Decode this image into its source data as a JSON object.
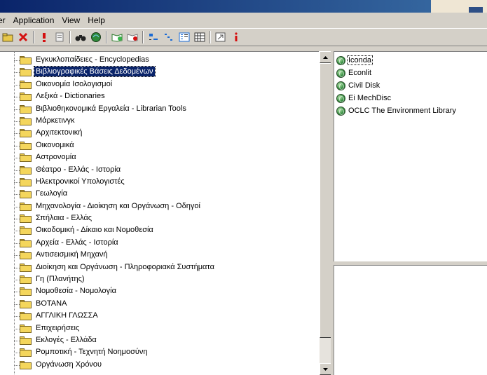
{
  "menu": {
    "items": [
      "er",
      "Application",
      "View",
      "Help"
    ]
  },
  "toolbar": {
    "icons": [
      "open-folder-icon",
      "delete-x-icon",
      "exclamation-icon",
      "document-icon",
      "binoculars-icon",
      "globe-refresh-icon",
      "open-book-icon",
      "close-book-icon",
      "sort-icon",
      "tree-view-icon",
      "details-view-icon",
      "grid-view-icon",
      "export-icon",
      "info-icon"
    ]
  },
  "tree": {
    "items": [
      {
        "label": "Εγκυκλοπαίδειες - Encyclopedias",
        "selected": false
      },
      {
        "label": "Βιβλιογραφικές Βάσεις Δεδομένων",
        "selected": true
      },
      {
        "label": "Οικονομία Ισολογισμοί",
        "selected": false
      },
      {
        "label": "Λεξικά - Dictionaries",
        "selected": false
      },
      {
        "label": "Βιβλιοθηκονομικά Εργαλεία - Librarian Tools",
        "selected": false
      },
      {
        "label": "Μάρκετινγκ",
        "selected": false
      },
      {
        "label": "Αρχιτεκτονική",
        "selected": false
      },
      {
        "label": "Οικονομικά",
        "selected": false
      },
      {
        "label": "Αστρονομία",
        "selected": false
      },
      {
        "label": "Θέατρο - Ελλάς - Ιστορία",
        "selected": false
      },
      {
        "label": "Ηλεκτρονικοί Υπολογιστές",
        "selected": false
      },
      {
        "label": "Γεωλογία",
        "selected": false
      },
      {
        "label": "Μηχανολογία - Διοίκηση και Οργάνωση - Οδηγοί",
        "selected": false
      },
      {
        "label": "Σπήλαια - Ελλάς",
        "selected": false
      },
      {
        "label": "Οικοδομική - Δίκαιο και Νομοθεσία",
        "selected": false
      },
      {
        "label": "Αρχεία - Ελλάς - Ιστορία",
        "selected": false
      },
      {
        "label": "Αντισεισμική Μηχανή",
        "selected": false
      },
      {
        "label": "Διοίκηση και Οργάνωση - Πληροφοριακά Συστήματα",
        "selected": false
      },
      {
        "label": "Γη (Πλανήτης)",
        "selected": false
      },
      {
        "label": "Νομοθεσία - Νομολογία",
        "selected": false
      },
      {
        "label": "BOTANA",
        "selected": false
      },
      {
        "label": "ΑΓΓΛΙΚΗ ΓΛΩΣΣΑ",
        "selected": false
      },
      {
        "label": "Επιχειρήσεις",
        "selected": false
      },
      {
        "label": "Εκλογές - Ελλάδα",
        "selected": false
      },
      {
        "label": "Ρομποτική - Τεχνητή Νοημοσύνη",
        "selected": false
      },
      {
        "label": "Οργάνωση Χρόνου",
        "selected": false
      }
    ]
  },
  "databases": {
    "items": [
      {
        "label": "Iconda",
        "selected": true
      },
      {
        "label": "Econlit",
        "selected": false
      },
      {
        "label": "Civil Disk",
        "selected": false
      },
      {
        "label": "Ei MechDisc",
        "selected": false
      },
      {
        "label": "OCLC The Environment Library",
        "selected": false
      }
    ]
  },
  "colors": {
    "selection": "#0a246a",
    "folder": "#f4d65c",
    "window_bg": "#d4d0c8"
  }
}
